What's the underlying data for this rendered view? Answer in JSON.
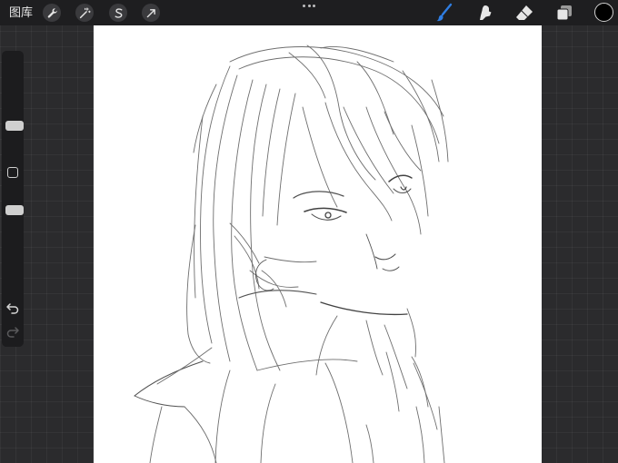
{
  "toolbar": {
    "gallery_label": "图库",
    "left_tools": [
      {
        "icon": "wrench-icon",
        "name": "actions-button"
      },
      {
        "icon": "magic-wand-icon",
        "name": "adjustments-button"
      },
      {
        "icon": "selection-s-icon",
        "name": "selection-button"
      },
      {
        "icon": "transform-arrow-icon",
        "name": "transform-button"
      }
    ],
    "right_tools": [
      {
        "icon": "brush-icon",
        "name": "paint-tool",
        "active": true
      },
      {
        "icon": "smudge-icon",
        "name": "smudge-tool"
      },
      {
        "icon": "eraser-icon",
        "name": "eraser-tool"
      },
      {
        "icon": "layers-icon",
        "name": "layers-button"
      }
    ],
    "active_color": "#000000",
    "accent_color": "#2f7de1"
  },
  "sidebar": {
    "brush_size_level": 0.3,
    "opacity_level": 0.8,
    "undo_icon": "undo-icon",
    "redo_icon": "redo-icon"
  }
}
